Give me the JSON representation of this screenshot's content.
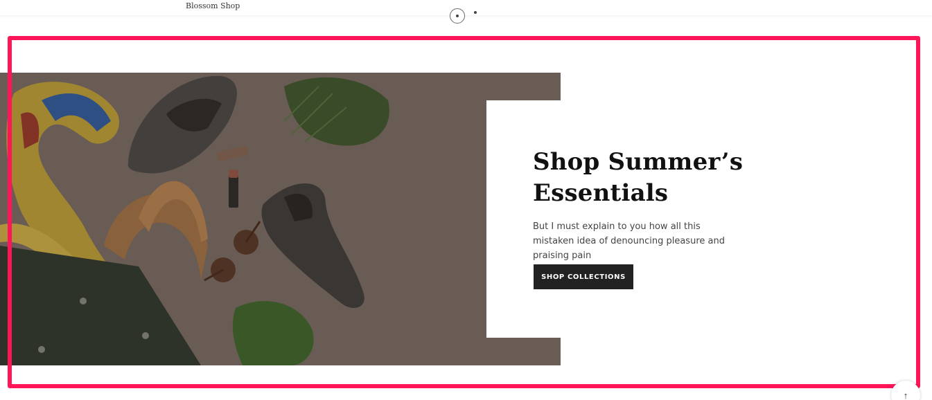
{
  "header": {
    "site_name": "Blossom Shop"
  },
  "slider": {
    "dot_count": 2,
    "active_index": 0
  },
  "hero": {
    "headline": "Shop Summer’s Essentials",
    "body": "But I must explain to you how all this mistaken idea of denouncing pleasure and praising pain",
    "cta_label": "SHOP COLLECTIONS"
  },
  "scroll_top": {
    "icon": "arrow-up-icon",
    "glyph": "↑"
  },
  "colors": {
    "highlight": "#ff1659",
    "cta_bg": "#222222",
    "image_bg": "#7d7068"
  }
}
